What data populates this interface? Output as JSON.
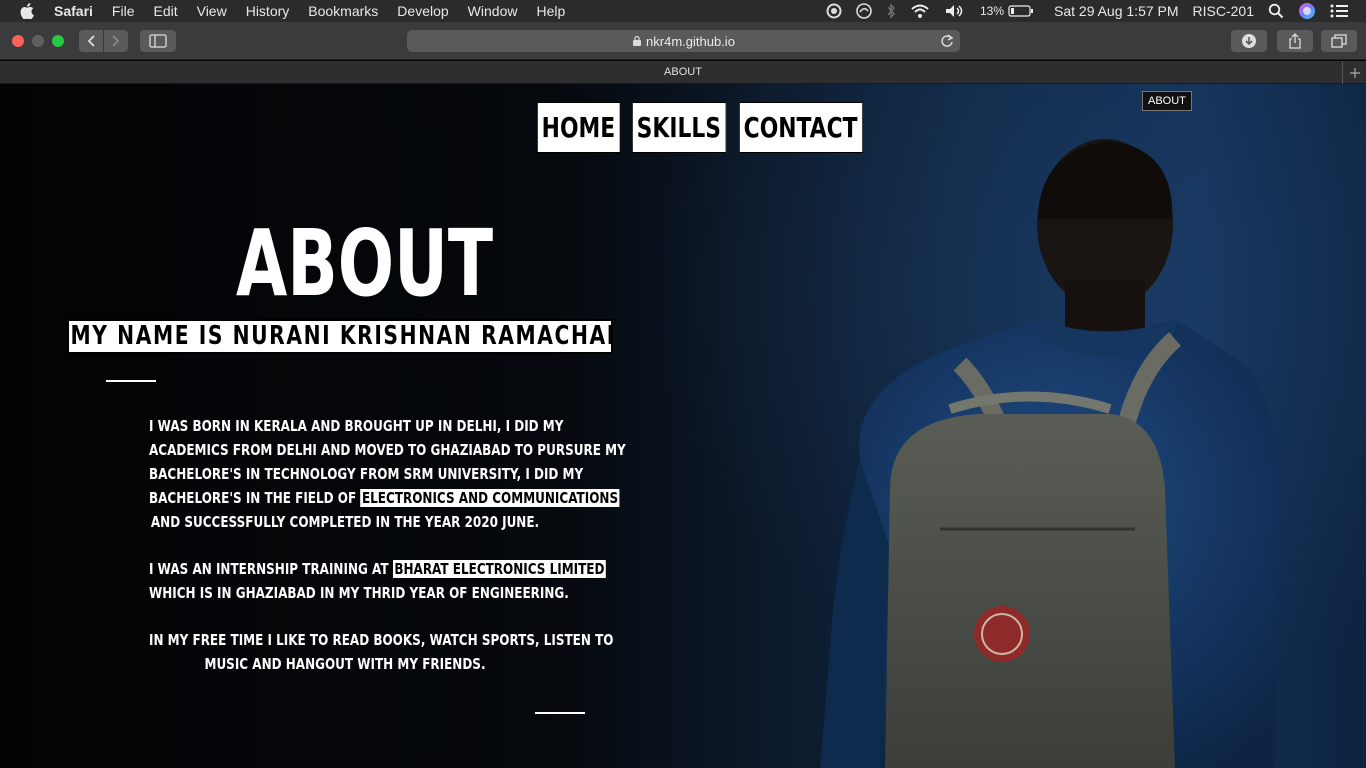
{
  "menubar": {
    "app_name": "Safari",
    "items": [
      "File",
      "Edit",
      "View",
      "History",
      "Bookmarks",
      "Develop",
      "Window",
      "Help"
    ],
    "battery": "13%",
    "datetime": "Sat 29 Aug  1:57 PM",
    "user": "RISC-201"
  },
  "toolbar": {
    "url": "nkr4m.github.io"
  },
  "tab": {
    "title": "ABOUT"
  },
  "page": {
    "tooltip": "ABOUT",
    "nav": [
      "HOME",
      "SKILLS",
      "CONTACT"
    ],
    "title": "ABOUT",
    "name_line": "MY NAME IS NURANI KRISHNAN RAMACHANDRAN",
    "para1": {
      "l1": "I WAS BORN IN KERALA AND BROUGHT UP IN DELHI, I DID MY",
      "l2": "ACADEMICS FROM DELHI AND MOVED TO GHAZIABAD TO PURSURE MY",
      "l3": "BACHELORE'S IN TECHNOLOGY FROM SRM UNIVERSITY, I DID MY",
      "l4_pre": "BACHELORE'S IN THE FIELD OF ",
      "l4_hl": "ELECTRONICS AND COMMUNICATIONS",
      "l5": "AND SUCCESSFULLY COMPLETED IN THE YEAR 2020 JUNE."
    },
    "para2": {
      "l1_pre": "I WAS AN INTERNSHIP TRAINING AT ",
      "l1_hl": "BHARAT ELECTRONICS LIMITED",
      "l2": "WHICH IS IN GHAZIABAD IN MY THRID YEAR OF ENGINEERING."
    },
    "para3": {
      "l1": "IN MY FREE TIME I LIKE TO READ BOOKS, WATCH SPORTS, LISTEN TO",
      "l2": "MUSIC AND HANGOUT WITH MY FRIENDS."
    }
  },
  "colors": {
    "menubar_bg": "#2b2b2c",
    "toolbar_bg": "#3b3b3d",
    "highlight_bg": "#ffffff",
    "text": "#ffffff"
  }
}
